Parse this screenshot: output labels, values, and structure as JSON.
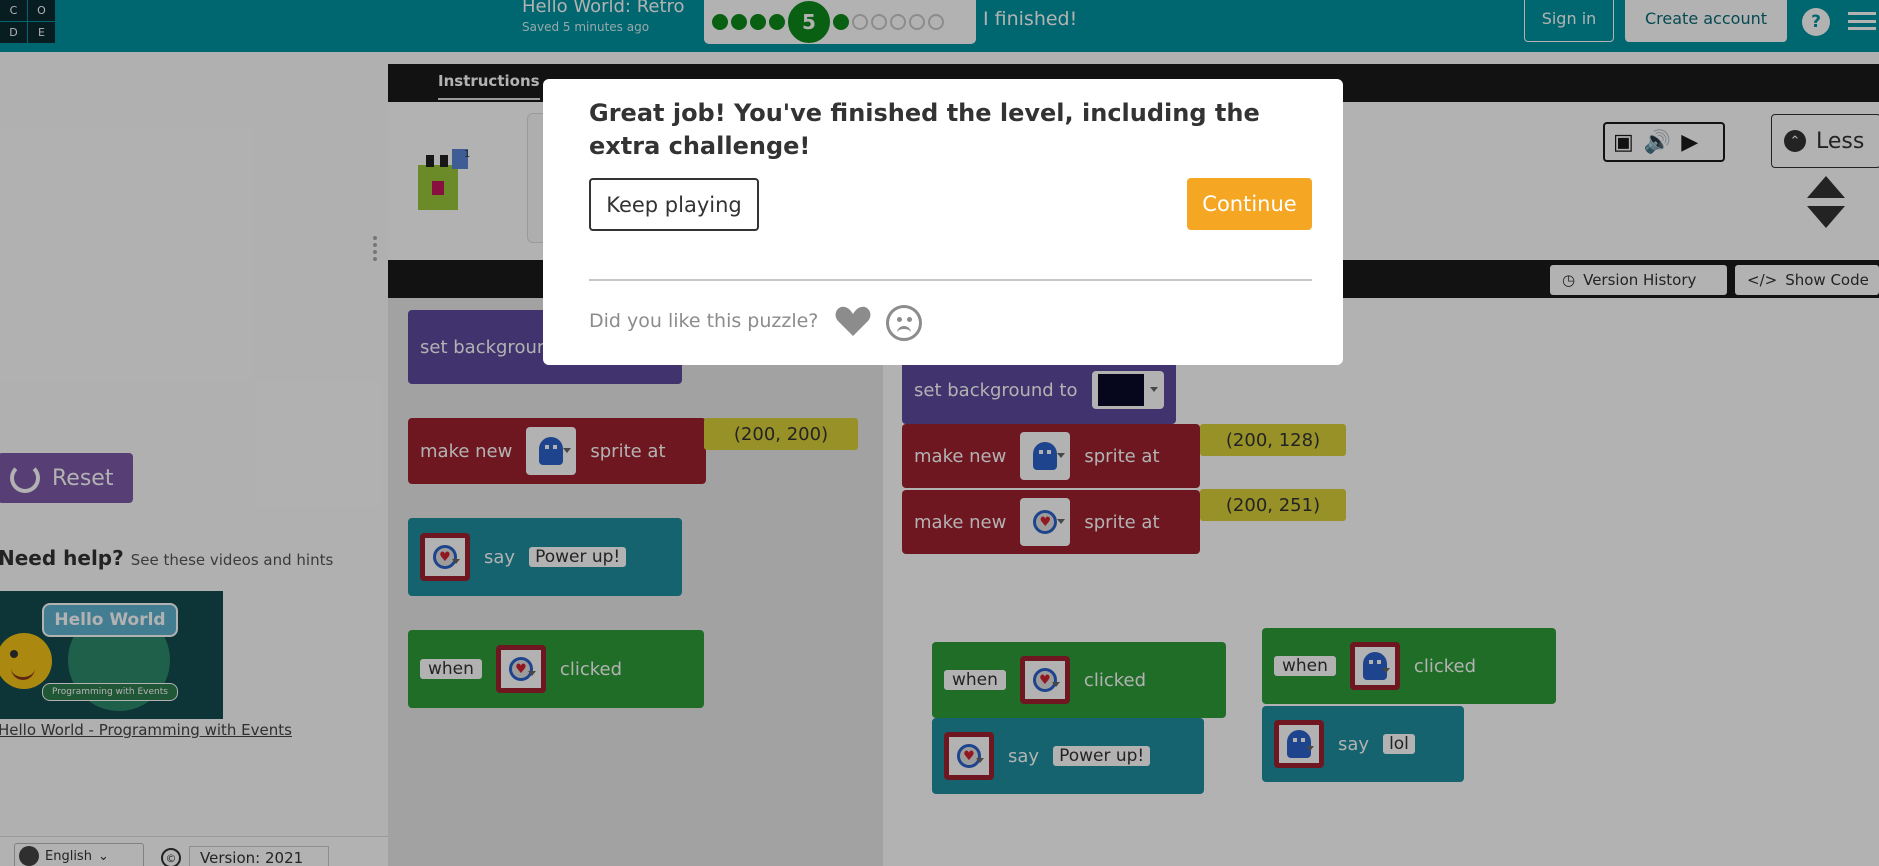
{
  "header": {
    "logo_letters": [
      "C",
      "O",
      "D",
      "E"
    ],
    "project_title": "Hello World: Retro",
    "saved_status": "Saved 5 minutes ago",
    "progress": {
      "current_level": "5",
      "completed_before": 4,
      "remaining_after": 6
    },
    "finished_label": "I finished!",
    "sign_in": "Sign in",
    "create_account": "Create account",
    "help": "?"
  },
  "left_panel": {
    "reset": "Reset",
    "need_help": "Need help?",
    "need_help_sub": "See these videos and hints",
    "video_title": "Hello World",
    "video_subtitle": "Programming with Events",
    "video_link": "Hello World - Programming with Events",
    "language": "English",
    "copyright": "©",
    "version": "Version: 2021"
  },
  "instructions": {
    "tab": "Instructions",
    "collapse_label": "Less"
  },
  "workspace": {
    "version_history": "Version History",
    "show_code": "Show Code"
  },
  "toolbox_blocks": {
    "set_background": "set background",
    "make_new": "make new",
    "sprite_at": "sprite at",
    "coord": "(200, 200)",
    "say": "say",
    "say_text": "Power up!",
    "when": "when",
    "clicked": "clicked"
  },
  "workarea_blocks": {
    "set_background_to": "set background to",
    "make_new_1": "make new",
    "sprite_at_1": "sprite at",
    "coord_1": "(200, 128)",
    "make_new_2": "make new",
    "sprite_at_2": "sprite at",
    "coord_2": "(200, 251)",
    "when_1": "when",
    "clicked_1": "clicked",
    "say_1": "say",
    "say_text_1": "Power up!",
    "when_2": "when",
    "clicked_2": "clicked",
    "say_2": "say",
    "say_text_2": "lol"
  },
  "modal": {
    "title": "Great job! You've finished the level, including the extra challenge!",
    "keep_playing": "Keep playing",
    "continue": "Continue",
    "feedback_question": "Did you like this puzzle?"
  },
  "colors": {
    "header": "#0094a1",
    "continue": "#f5a623",
    "reset": "#7d5aa8",
    "event_green": "#2e9d3a",
    "sprite_red": "#a02230"
  }
}
